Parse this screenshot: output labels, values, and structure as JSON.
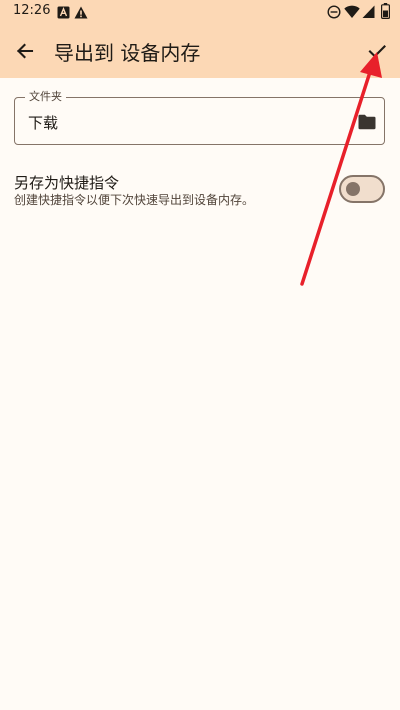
{
  "status_bar": {
    "time": "12:26",
    "left_icons": [
      "font-notification-icon",
      "warning-icon"
    ],
    "right_icons": [
      "do-not-disturb-icon",
      "wifi-icon",
      "cellular-signal-icon",
      "battery-icon"
    ]
  },
  "app_bar": {
    "back_icon": "arrow-back-icon",
    "title": "导出到 设备内存",
    "confirm_icon": "check-icon"
  },
  "folder_field": {
    "label": "文件夹",
    "value": "下载",
    "icon": "folder-icon"
  },
  "shortcut": {
    "title": "另存为快捷指令",
    "description": "创建快捷指令以便下次快速导出到设备内存。",
    "enabled": false
  },
  "annotation": {
    "type": "arrow",
    "color": "#E8202A",
    "points_to": "confirm-button"
  },
  "colors": {
    "app_bar_bg": "#FCD8B5",
    "page_bg": "#FFFBF6",
    "outline": "#857468",
    "text_primary": "#1F1B16",
    "text_secondary": "#51443A"
  }
}
